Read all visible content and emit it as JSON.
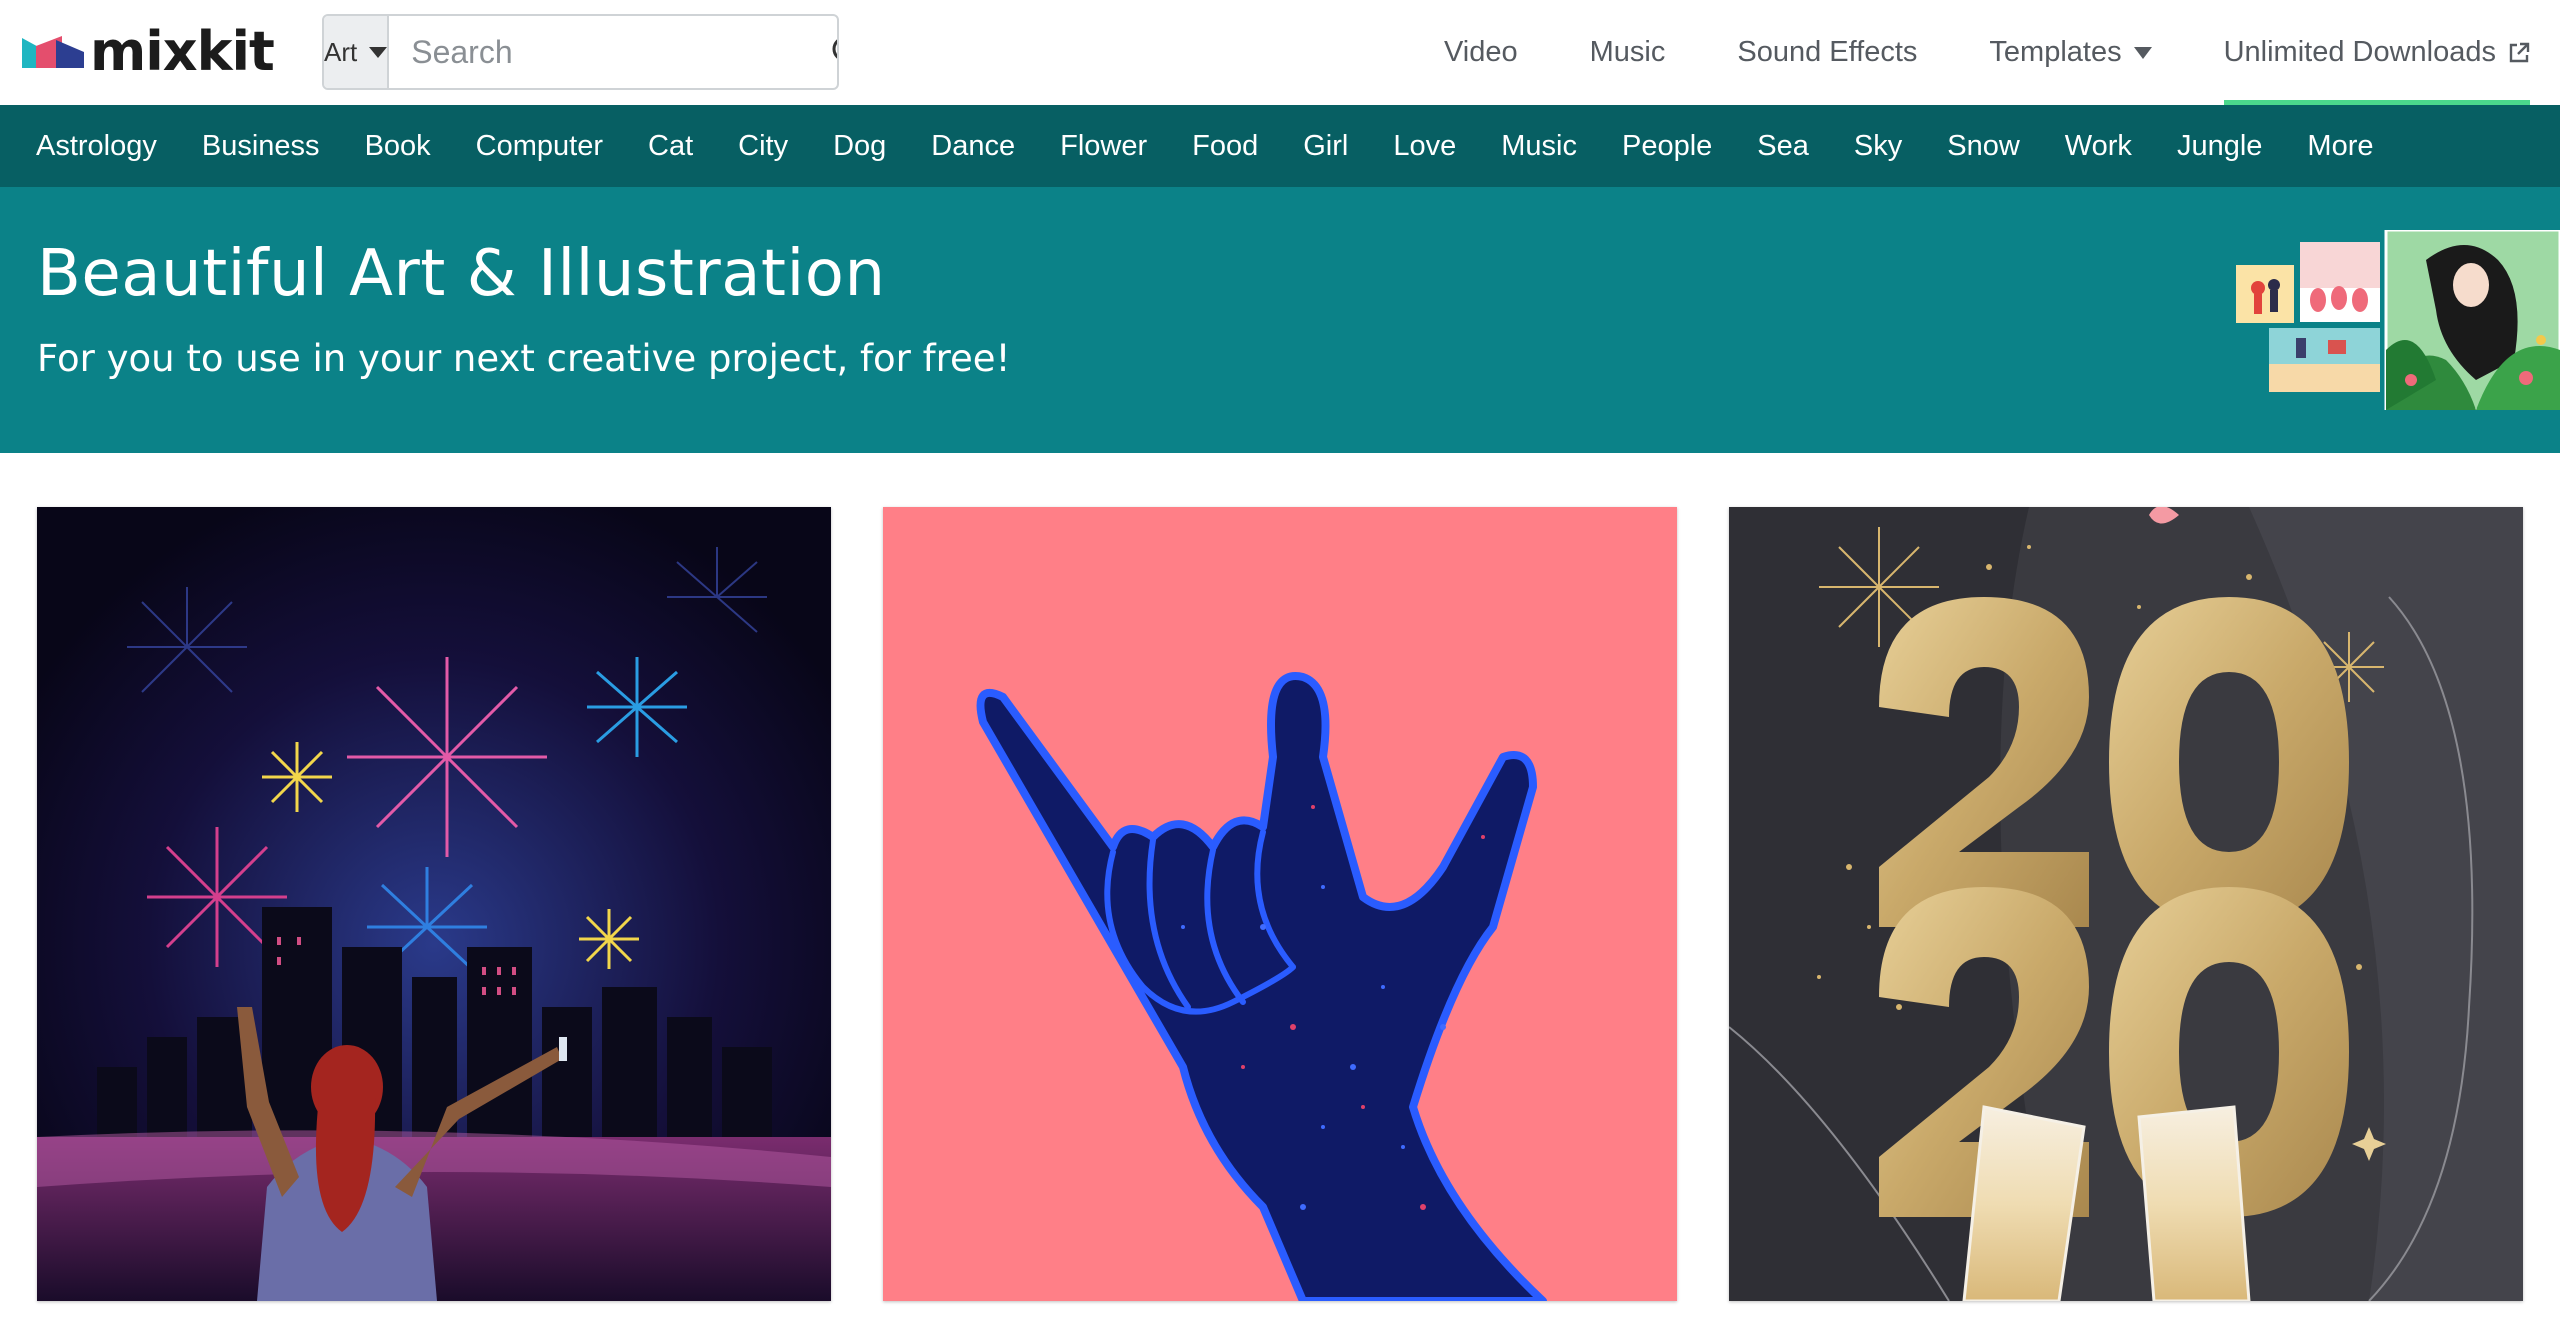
{
  "brand": {
    "name": "mixkit"
  },
  "search": {
    "category": "Art",
    "placeholder": "Search"
  },
  "topnav": {
    "items": [
      {
        "label": "Video"
      },
      {
        "label": "Music"
      },
      {
        "label": "Sound Effects"
      },
      {
        "label": "Templates"
      },
      {
        "label": "Unlimited Downloads"
      }
    ]
  },
  "categories": [
    "Astrology",
    "Business",
    "Book",
    "Computer",
    "Cat",
    "City",
    "Dog",
    "Dance",
    "Flower",
    "Food",
    "Girl",
    "Love",
    "Music",
    "People",
    "Sea",
    "Sky",
    "Snow",
    "Work",
    "Jungle",
    "More"
  ],
  "hero": {
    "title": "Beautiful Art & Illustration",
    "subtitle": "For you to use in your next creative project, for free!"
  },
  "gallery": [
    {
      "subject": "fireworks-over-city"
    },
    {
      "subject": "rock-hand-sign"
    },
    {
      "subject": "2020-new-year"
    }
  ],
  "colors": {
    "nav_bar": "#075f63",
    "hero": "#0b8288",
    "active_underline": "#4bd88c",
    "card_pink": "#ff7f87",
    "card_gold": "#c9a96a"
  }
}
